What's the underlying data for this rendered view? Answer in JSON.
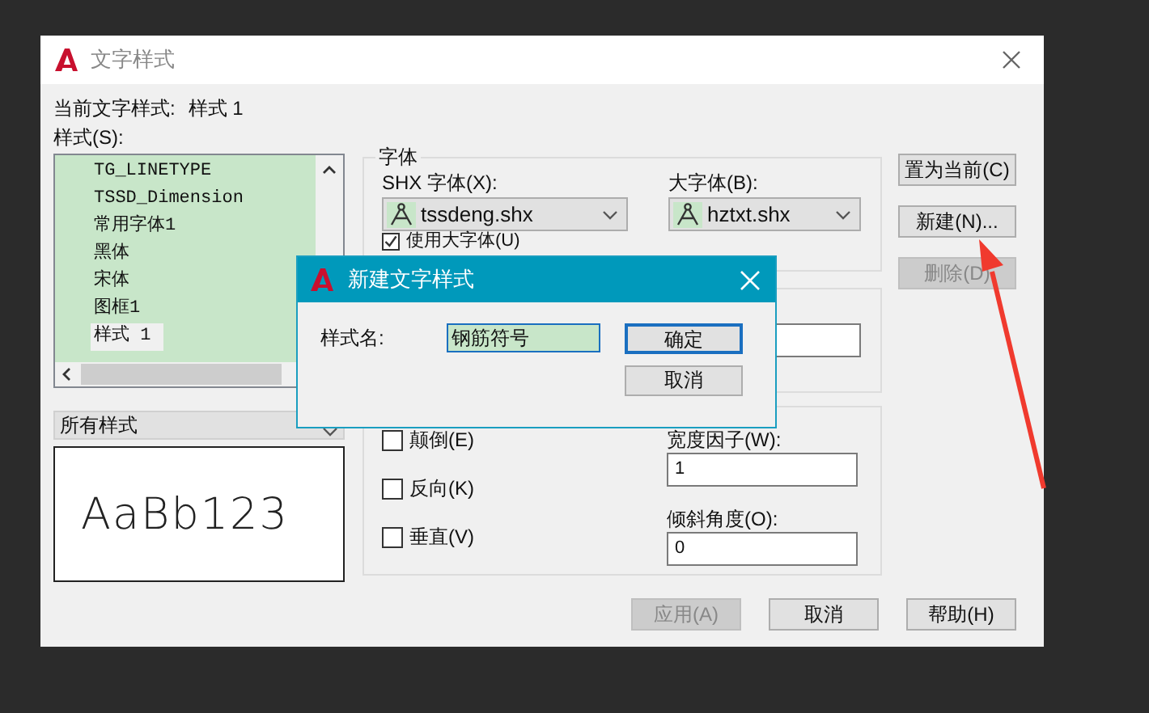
{
  "window": {
    "title": "文字样式"
  },
  "current_style": {
    "label": "当前文字样式:",
    "value": "样式 1"
  },
  "styles": {
    "label": "样式(S):",
    "items": [
      {
        "name": "TG_LINETYPE",
        "selected": false
      },
      {
        "name": "TSSD_Dimension",
        "selected": false
      },
      {
        "name": "常用字体1",
        "selected": false
      },
      {
        "name": "黑体",
        "selected": false
      },
      {
        "name": "宋体",
        "selected": false
      },
      {
        "name": "图框1",
        "selected": false
      },
      {
        "name": "样式 1",
        "selected": true
      }
    ]
  },
  "filter": {
    "value": "所有样式"
  },
  "preview": {
    "sample": "AaBb123"
  },
  "font": {
    "title": "字体",
    "shx_label": "SHX 字体(X):",
    "shx_value": "tssdeng.shx",
    "big_label": "大字体(B):",
    "big_value": "hztxt.shx",
    "use_big": {
      "label": "使用大字体(U)",
      "checked": true
    }
  },
  "effects": {
    "checkboxes": [
      {
        "label": "颠倒(E)",
        "checked": false
      },
      {
        "label": "反向(K)",
        "checked": false
      },
      {
        "label": "垂直(V)",
        "checked": false
      }
    ],
    "width_label": "宽度因子(W):",
    "width_value": "1",
    "oblique_label": "倾斜角度(O):",
    "oblique_value": "0"
  },
  "side_buttons": [
    {
      "label": "置为当前(C)",
      "disabled": false
    },
    {
      "label": "新建(N)...",
      "disabled": false
    },
    {
      "label": "删除(D)",
      "disabled": true
    }
  ],
  "bottom_buttons": [
    {
      "label": "应用(A)",
      "disabled": true
    },
    {
      "label": "取消",
      "disabled": false
    },
    {
      "label": "帮助(H)",
      "disabled": false
    }
  ],
  "new_style_dialog": {
    "title": "新建文字样式",
    "name_label": "样式名:",
    "name_value": "钢筋符号",
    "buttons": [
      {
        "label": "确定",
        "default": true
      },
      {
        "label": "取消",
        "default": false
      }
    ]
  }
}
